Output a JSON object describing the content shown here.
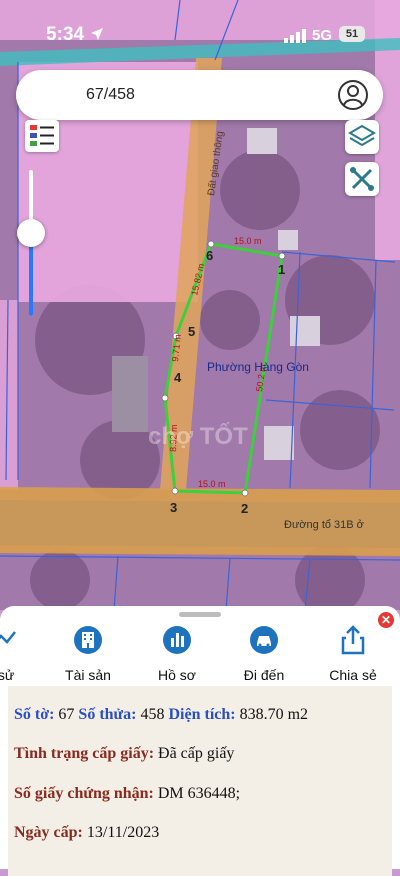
{
  "status_bar": {
    "time": "5:34",
    "network": "5G",
    "battery": "51"
  },
  "search": {
    "value": "67/458"
  },
  "map": {
    "ward_label": "Phường Hàng Gòn",
    "road_label": "Đường tổ 31B ở",
    "side_road_label": "Đất giao thông",
    "watermark": "chợ TỐT",
    "vertices": [
      "1",
      "2",
      "3",
      "4",
      "5",
      "6"
    ],
    "edge_labels": [
      "15.0 m",
      "50.2 m",
      "15.0 m",
      "8.92 m",
      "9.71 m",
      "15.82 m"
    ]
  },
  "actions": [
    {
      "label": "sử",
      "icon": "history-icon"
    },
    {
      "label": "Tài sản",
      "icon": "building-icon"
    },
    {
      "label": "Hồ sơ",
      "icon": "document-chart-icon"
    },
    {
      "label": "Đi đến",
      "icon": "car-icon"
    },
    {
      "label": "Chia sẻ",
      "icon": "share-icon"
    }
  ],
  "info": {
    "so_to_label": "Số tờ:",
    "so_to_value": "67",
    "so_thua_label": "Số thửa:",
    "so_thua_value": "458",
    "dien_tich_label": "Diện tích:",
    "dien_tich_value": "838.70 m2",
    "tinh_trang_label": "Tình trạng cấp giấy:",
    "tinh_trang_value": "Đã cấp giấy",
    "so_giay_label": "Số giấy chứng nhận:",
    "so_giay_value": "DM 636448;",
    "ngay_cap_label": "Ngày cấp:",
    "ngay_cap_value": "13/11/2023"
  }
}
